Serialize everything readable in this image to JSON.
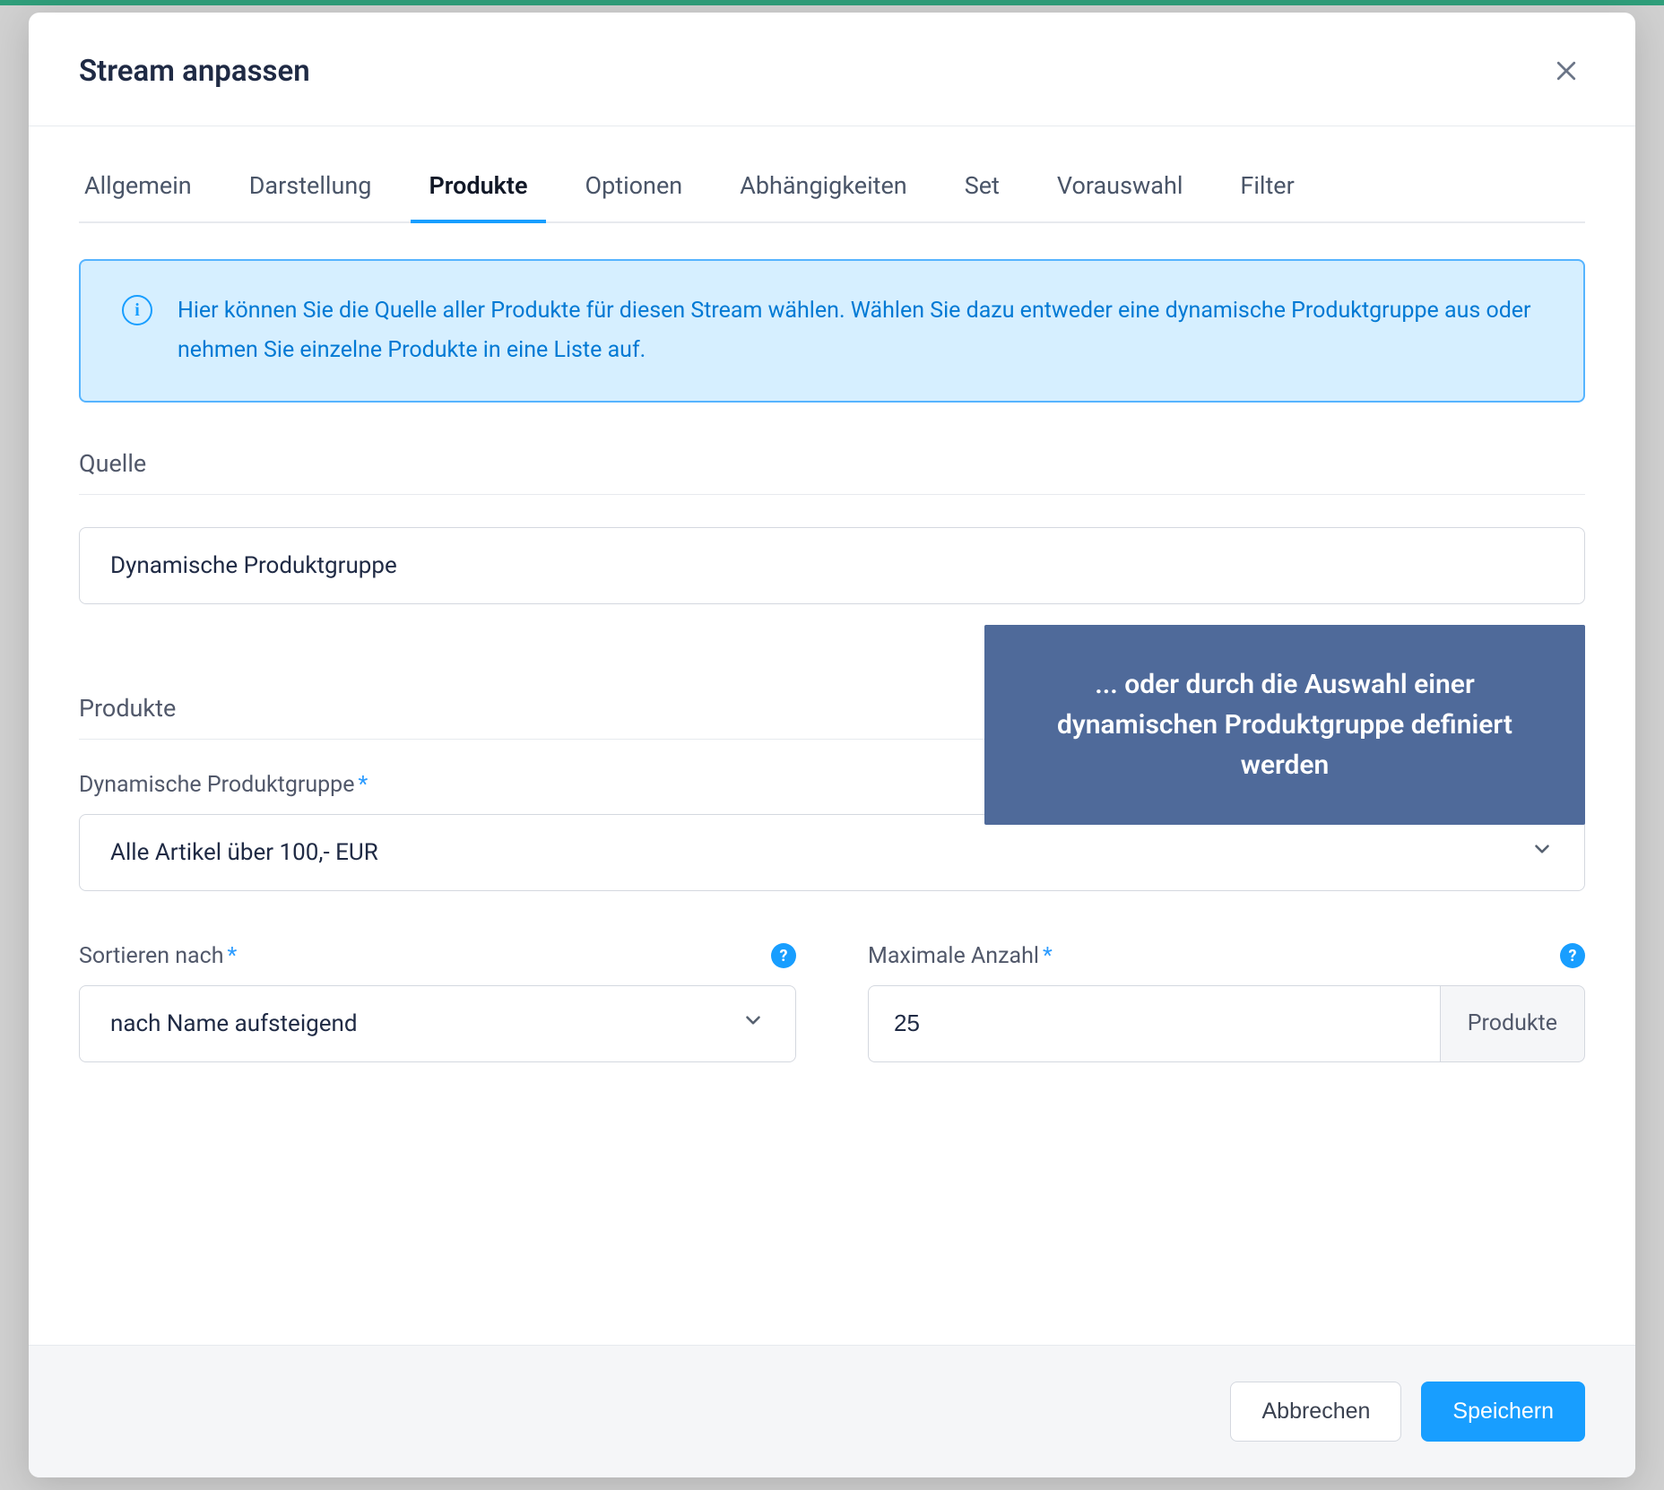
{
  "modal": {
    "title": "Stream anpassen"
  },
  "tabs": [
    {
      "label": "Allgemein",
      "active": false
    },
    {
      "label": "Darstellung",
      "active": false
    },
    {
      "label": "Produkte",
      "active": true
    },
    {
      "label": "Optionen",
      "active": false
    },
    {
      "label": "Abhängigkeiten",
      "active": false
    },
    {
      "label": "Set",
      "active": false
    },
    {
      "label": "Vorauswahl",
      "active": false
    },
    {
      "label": "Filter",
      "active": false
    }
  ],
  "info": {
    "text": "Hier können Sie die Quelle aller Produkte für diesen Stream wählen. Wählen Sie dazu entweder eine dynamische Produktgruppe aus oder nehmen Sie einzelne Produkte in eine Liste auf."
  },
  "sections": {
    "source_label": "Quelle",
    "source_value": "Dynamische Produktgruppe",
    "products_label": "Produkte",
    "dyn_group": {
      "label": "Dynamische Produktgruppe",
      "value": "Alle Artikel über 100,- EUR"
    },
    "sort": {
      "label": "Sortieren nach",
      "value": "nach Name aufsteigend"
    },
    "max": {
      "label": "Maximale Anzahl",
      "value": "25",
      "suffix": "Produkte"
    }
  },
  "tooltip": {
    "text": "... oder durch die Auswahl einer dynamischen Produktgruppe definiert werden"
  },
  "footer": {
    "cancel": "Abbrechen",
    "save": "Speichern"
  }
}
